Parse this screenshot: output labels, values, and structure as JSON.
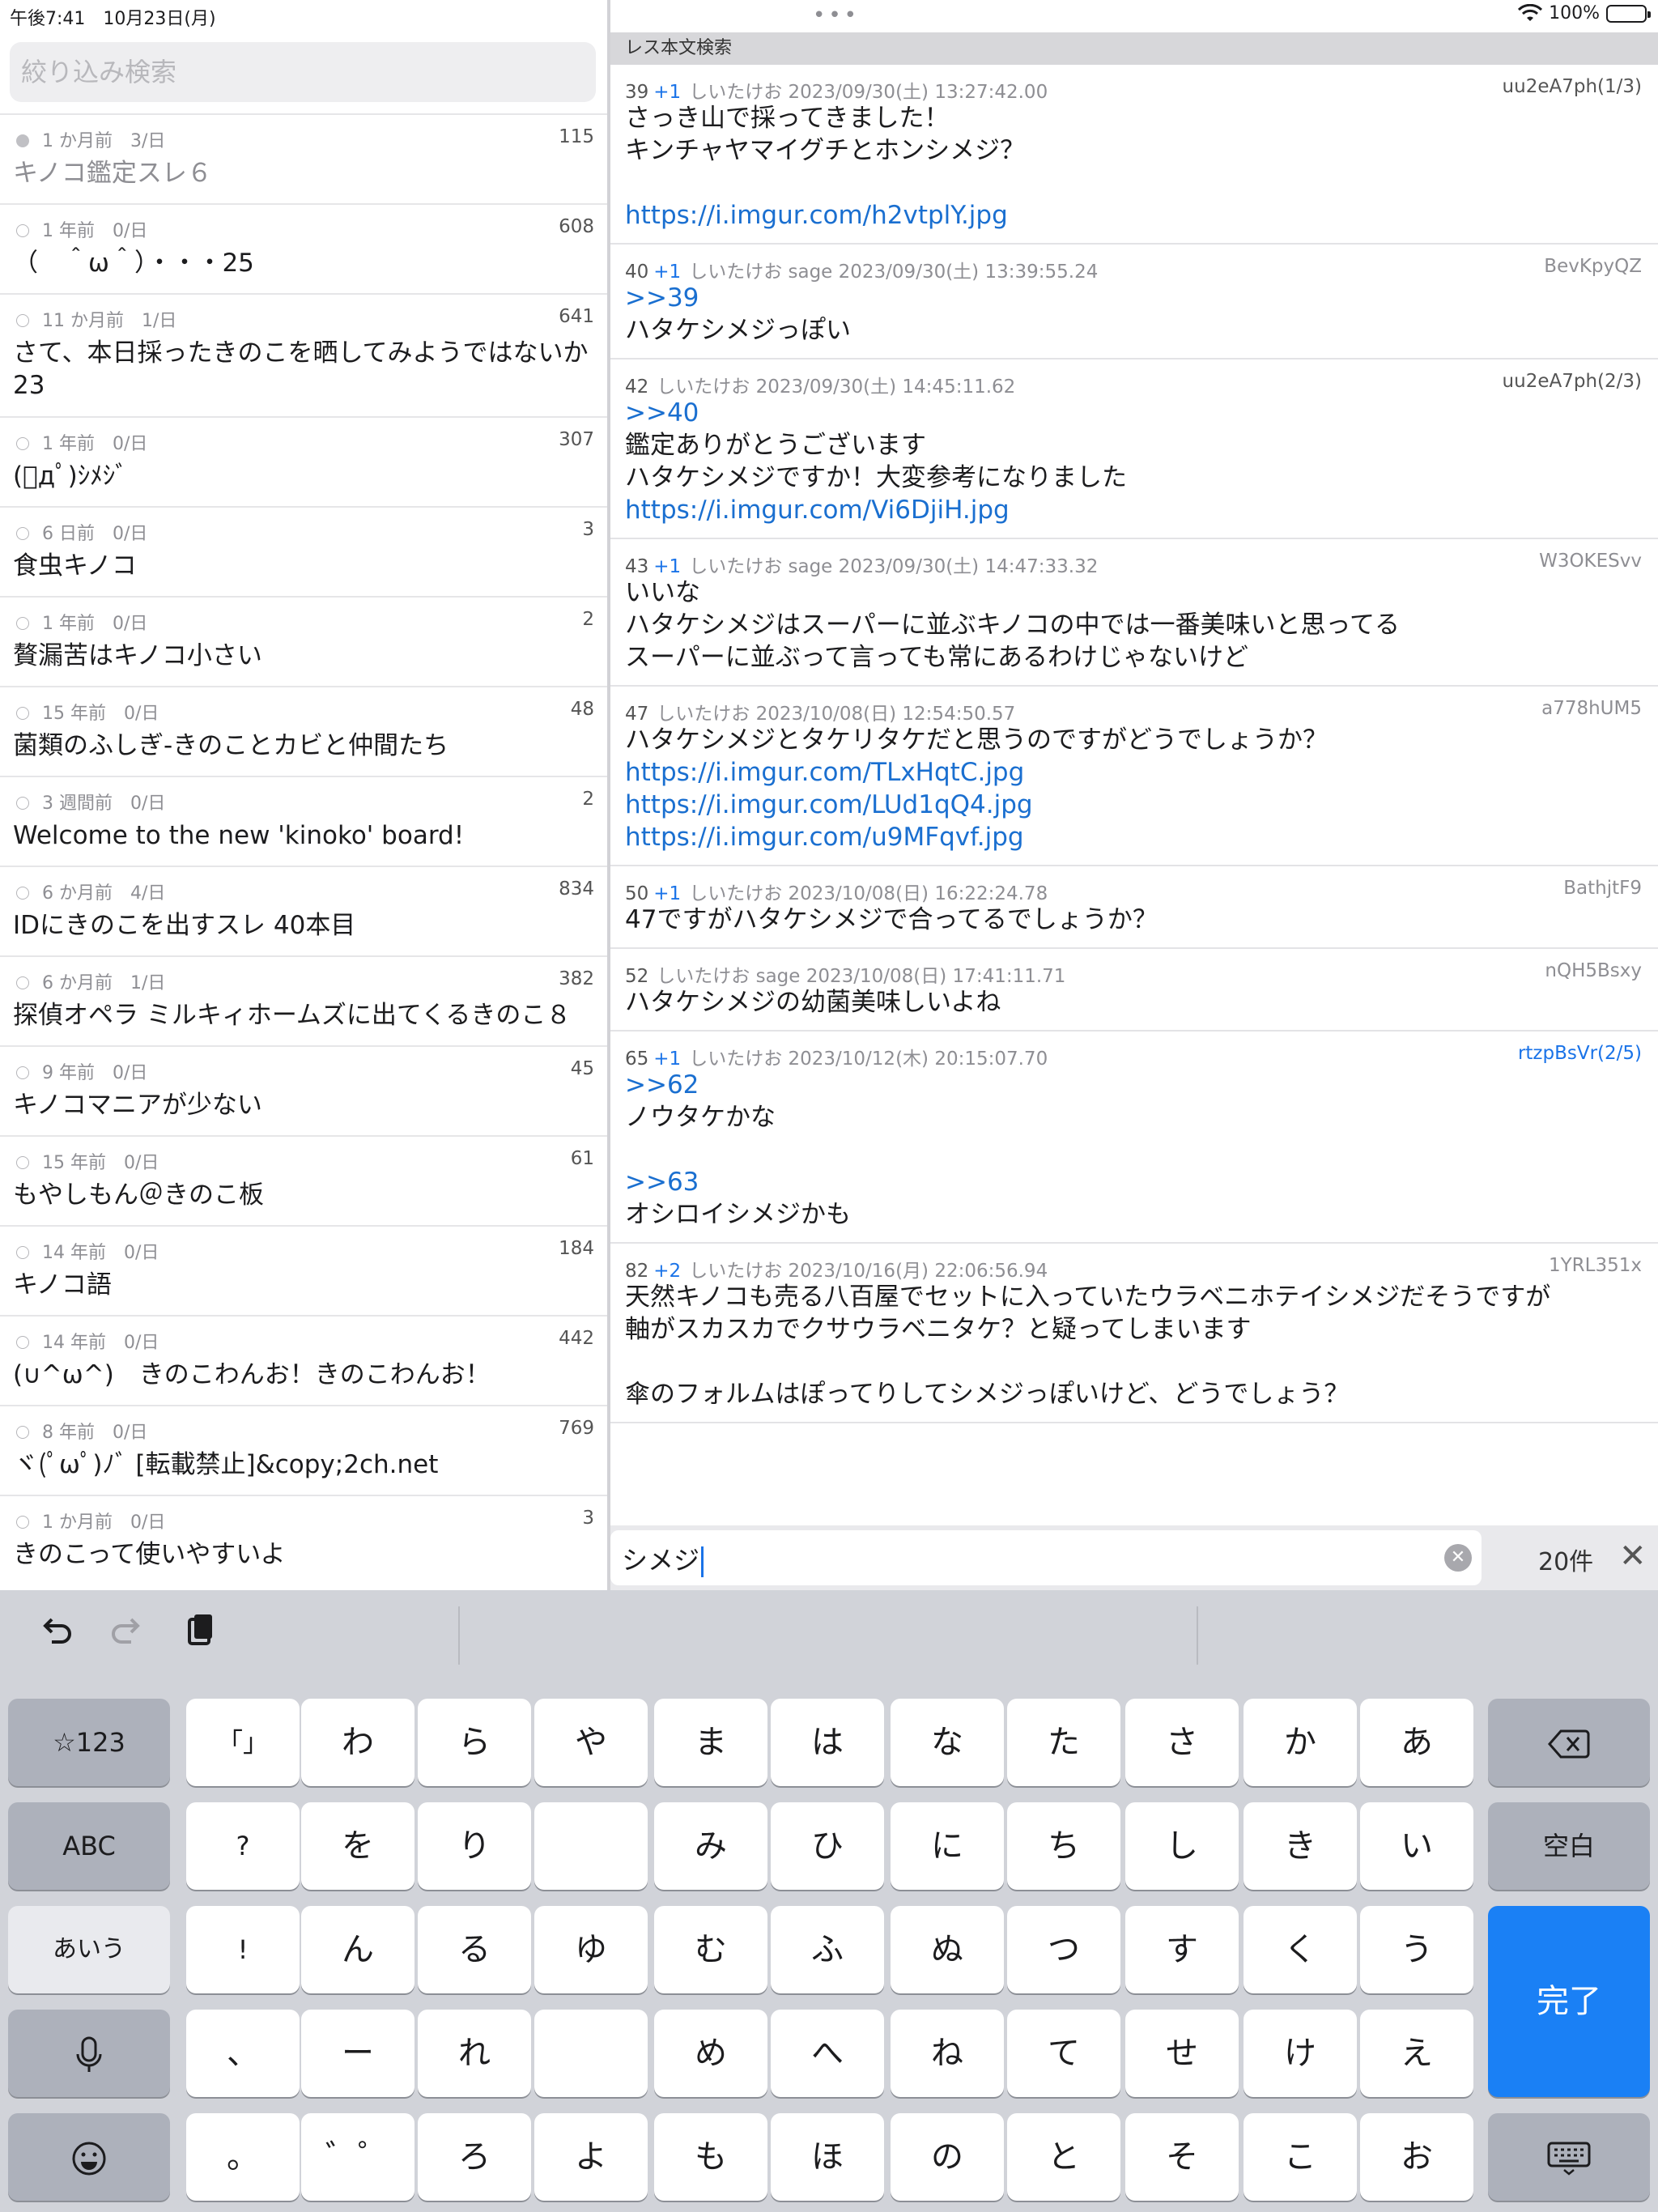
{
  "status": {
    "time_date": "午後7:41　10月23日(月)",
    "battery_pct": "100%"
  },
  "left": {
    "filter_placeholder": "絞り込み検索",
    "threads": [
      {
        "meta": "1 か月前　3/日",
        "count": "115",
        "title": "キノコ鑑定スレ６",
        "read": true
      },
      {
        "meta": "1 年前　0/日",
        "count": "608",
        "title": "（　＾ω＾）・・・25",
        "read": false
      },
      {
        "meta": "11 か月前　1/日",
        "count": "641",
        "title": "さて、本日採ったきのこを晒してみようではないか23",
        "read": false
      },
      {
        "meta": "1 年前　0/日",
        "count": "307",
        "title": "(ﾟдﾟ)ｼﾒｼﾞ",
        "read": false
      },
      {
        "meta": "6 日前　0/日",
        "count": "3",
        "title": "食虫キノコ",
        "read": false
      },
      {
        "meta": "1 年前　0/日",
        "count": "2",
        "title": "贅漏苦はキノコ小さい",
        "read": false
      },
      {
        "meta": "15 年前　0/日",
        "count": "48",
        "title": "菌類のふしぎ-きのことカビと仲間たち",
        "read": false
      },
      {
        "meta": "3 週間前　0/日",
        "count": "2",
        "title": "Welcome to the new 'kinoko' board!",
        "read": false
      },
      {
        "meta": "6 か月前　4/日",
        "count": "834",
        "title": "IDにきのこを出すスレ 40本目",
        "read": false
      },
      {
        "meta": "6 か月前　1/日",
        "count": "382",
        "title": "探偵オペラ ミルキィホームズに出てくるきのこ８",
        "read": false
      },
      {
        "meta": "9 年前　0/日",
        "count": "45",
        "title": "キノコマニアが少ない",
        "read": false
      },
      {
        "meta": "15 年前　0/日",
        "count": "61",
        "title": "もやしもん＠きのこ板",
        "read": false
      },
      {
        "meta": "14 年前　0/日",
        "count": "184",
        "title": "キノコ語",
        "read": false
      },
      {
        "meta": "14 年前　0/日",
        "count": "442",
        "title": "(∪^ω^)　きのこわんお！きのこわんお！",
        "read": false
      },
      {
        "meta": "8 年前　0/日",
        "count": "769",
        "title": "ヾ(ﾟωﾟ)ﾉﾞ [転載禁止]&copy;2ch.net",
        "read": false
      },
      {
        "meta": "1 か月前　0/日",
        "count": "3",
        "title": "きのこって使いやすいよ",
        "read": false
      }
    ]
  },
  "right": {
    "header": "レス本文検索",
    "posts": [
      {
        "num": "39",
        "plus": "+1",
        "name": "しいたけお",
        "date": "2023/09/30(土) 13:27:42.00",
        "id": "uu2eA7ph(1/3)",
        "id_style": "dark",
        "lines": [
          {
            "t": "さっき山で採ってきました！",
            "k": "text"
          },
          {
            "t": "キンチャヤマイグチとホンシメジ？",
            "k": "text"
          },
          {
            "t": "",
            "k": "text"
          },
          {
            "t": "https://i.imgur.com/h2vtplY.jpg",
            "k": "link"
          }
        ]
      },
      {
        "num": "40",
        "plus": "+1",
        "name": "しいたけお sage",
        "date": "2023/09/30(土) 13:39:55.24",
        "id": "BevKpyQZ",
        "id_style": "gray",
        "lines": [
          {
            "t": ">>39",
            "k": "anchor"
          },
          {
            "t": "ハタケシメジっぽい",
            "k": "text"
          }
        ]
      },
      {
        "num": "42",
        "plus": "",
        "name": "しいたけお",
        "date": "2023/09/30(土) 14:45:11.62",
        "id": "uu2eA7ph(2/3)",
        "id_style": "dark",
        "lines": [
          {
            "t": ">>40",
            "k": "anchor"
          },
          {
            "t": "鑑定ありがとうございます",
            "k": "text"
          },
          {
            "t": "ハタケシメジですか！大変参考になりました",
            "k": "text"
          },
          {
            "t": "https://i.imgur.com/Vi6DjiH.jpg",
            "k": "link"
          }
        ]
      },
      {
        "num": "43",
        "plus": "+1",
        "name": "しいたけお sage",
        "date": "2023/09/30(土) 14:47:33.32",
        "id": "W3OKESvv",
        "id_style": "gray",
        "lines": [
          {
            "t": "いいな",
            "k": "text"
          },
          {
            "t": "ハタケシメジはスーパーに並ぶキノコの中では一番美味いと思ってる",
            "k": "text"
          },
          {
            "t": "スーパーに並ぶって言っても常にあるわけじゃないけど",
            "k": "text"
          }
        ]
      },
      {
        "num": "47",
        "plus": "",
        "name": "しいたけお",
        "date": "2023/10/08(日) 12:54:50.57",
        "id": "a778hUM5",
        "id_style": "gray",
        "lines": [
          {
            "t": "ハタケシメジとタケリタケだと思うのですがどうでしょうか？",
            "k": "text"
          },
          {
            "t": "https://i.imgur.com/TLxHqtC.jpg",
            "k": "link"
          },
          {
            "t": "https://i.imgur.com/LUd1qQ4.jpg",
            "k": "link"
          },
          {
            "t": "https://i.imgur.com/u9MFqvf.jpg",
            "k": "link"
          }
        ]
      },
      {
        "num": "50",
        "plus": "+1",
        "name": "しいたけお",
        "date": "2023/10/08(日) 16:22:24.78",
        "id": "BathjtF9",
        "id_style": "gray",
        "lines": [
          {
            "t": "47ですがハタケシメジで合ってるでしょうか？",
            "k": "text"
          }
        ]
      },
      {
        "num": "52",
        "plus": "",
        "name": "しいたけお sage",
        "date": "2023/10/08(日) 17:41:11.71",
        "id": "nQH5Bsxy",
        "id_style": "gray",
        "lines": [
          {
            "t": "ハタケシメジの幼菌美味しいよね",
            "k": "text"
          }
        ]
      },
      {
        "num": "65",
        "plus": "+1",
        "name": "しいたけお",
        "date": "2023/10/12(木) 20:15:07.70",
        "id": "rtzpBsVr(2/5)",
        "id_style": "blue",
        "lines": [
          {
            "t": ">>62",
            "k": "anchor"
          },
          {
            "t": "ノウタケかな",
            "k": "text"
          },
          {
            "t": "",
            "k": "text"
          },
          {
            "t": ">>63",
            "k": "anchor"
          },
          {
            "t": "オシロイシメジかも",
            "k": "text"
          }
        ]
      },
      {
        "num": "82",
        "plus": "+2",
        "name": "しいたけお",
        "date": "2023/10/16(月) 22:06:56.94",
        "id": "1YRL351x",
        "id_style": "gray",
        "lines": [
          {
            "t": "天然キノコも売る八百屋でセットに入っていたウラベニホテイシメジだそうですが",
            "k": "text"
          },
          {
            "t": "軸がスカスカでクサウラベニタケ？と疑ってしまいます",
            "k": "text"
          },
          {
            "t": "",
            "k": "text"
          },
          {
            "t": "傘のフォルムはぽってりしてシメジっぽいけど、どうでしょう？",
            "k": "text"
          }
        ]
      }
    ]
  },
  "search": {
    "value": "シメジ",
    "result_count": "20件"
  },
  "keyboard": {
    "toolbar": {
      "undo": "undo-icon",
      "redo": "redo-icon",
      "paste": "paste-icon"
    },
    "left_keys": [
      "☆123",
      "ABC",
      "あいう",
      "mic-icon",
      "emoji-icon"
    ],
    "columns": [
      [
        "「」",
        "?",
        "!",
        "、",
        "。"
      ],
      [
        "わ",
        "を",
        "ん",
        "ー",
        "゛゜"
      ],
      [
        "ら",
        "り",
        "る",
        "れ",
        "ろ"
      ],
      [
        "や",
        "",
        "ゆ",
        "",
        "よ"
      ],
      [
        "ま",
        "み",
        "む",
        "め",
        "も"
      ],
      [
        "は",
        "ひ",
        "ふ",
        "へ",
        "ほ"
      ],
      [
        "な",
        "に",
        "ぬ",
        "ね",
        "の"
      ],
      [
        "た",
        "ち",
        "つ",
        "て",
        "と"
      ],
      [
        "さ",
        "し",
        "す",
        "せ",
        "そ"
      ],
      [
        "か",
        "き",
        "く",
        "け",
        "こ"
      ],
      [
        "あ",
        "い",
        "う",
        "え",
        "お"
      ]
    ],
    "right_keys": {
      "delete": "delete-icon",
      "space": "空白",
      "done": "完了",
      "hide": "keyboard-hide-icon"
    }
  }
}
